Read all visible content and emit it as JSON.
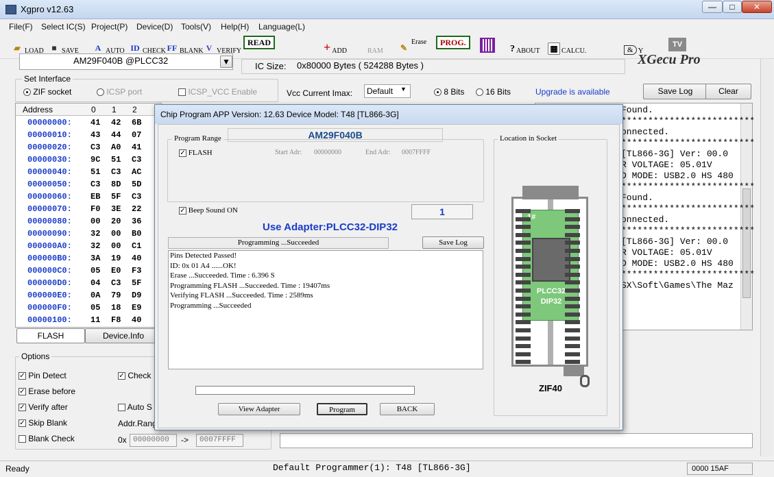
{
  "window": {
    "title": "Xgpro v12.63",
    "min": "—",
    "max": "□",
    "close": "✕"
  },
  "menu": [
    "File(F)",
    "Select IC(S)",
    "Project(P)",
    "Device(D)",
    "Tools(V)",
    "Help(H)",
    "Language(L)"
  ],
  "toolbar": {
    "load": "LOAD",
    "save": "SAVE",
    "auto": "AUTO",
    "check": "CHECK",
    "blank": "BLANK",
    "verify": "VERIFY",
    "read": "READ",
    "add": "ADD",
    "ram": "RAM",
    "erase": "Erase",
    "prog": "PROG.",
    "about": "ABOUT",
    "calcu": "CALCU.",
    "gate": "&",
    "gate_out": "Y",
    "tv": "TV"
  },
  "chip": {
    "name": "AM29F040B @PLCC32",
    "ic_size_label": "IC Size:",
    "ic_size_value": "0x80000 Bytes ( 524288 Bytes )",
    "brand": "XGecu Pro"
  },
  "interface": {
    "label": "Set Interface",
    "zif": "ZIF socket",
    "icsp": "ICSP port",
    "icsp_vcc": "ICSP_VCC Enable",
    "vcc_label": "Vcc Current Imax:",
    "vcc_value": "Default",
    "bits8": "8 Bits",
    "bits16": "16 Bits",
    "upgrade": "Upgrade is available",
    "save_log": "Save Log",
    "clear": "Clear"
  },
  "hex": {
    "header_addr": "Address",
    "cols": [
      "0",
      "1",
      "2"
    ],
    "rows": [
      {
        "addr": "00000000:",
        "b": [
          "41",
          "42",
          "6B"
        ]
      },
      {
        "addr": "00000010:",
        "b": [
          "43",
          "44",
          "07"
        ]
      },
      {
        "addr": "00000020:",
        "b": [
          "C3",
          "A0",
          "41"
        ]
      },
      {
        "addr": "00000030:",
        "b": [
          "9C",
          "51",
          "C3"
        ]
      },
      {
        "addr": "00000040:",
        "b": [
          "51",
          "C3",
          "AC"
        ]
      },
      {
        "addr": "00000050:",
        "b": [
          "C3",
          "8D",
          "5D"
        ]
      },
      {
        "addr": "00000060:",
        "b": [
          "EB",
          "5F",
          "C3"
        ]
      },
      {
        "addr": "00000070:",
        "b": [
          "F0",
          "3E",
          "22"
        ]
      },
      {
        "addr": "00000080:",
        "b": [
          "00",
          "20",
          "36"
        ]
      },
      {
        "addr": "00000090:",
        "b": [
          "32",
          "00",
          "B0"
        ]
      },
      {
        "addr": "000000A0:",
        "b": [
          "32",
          "00",
          "C1"
        ]
      },
      {
        "addr": "000000B0:",
        "b": [
          "3A",
          "19",
          "40"
        ]
      },
      {
        "addr": "000000C0:",
        "b": [
          "05",
          "E0",
          "F3"
        ]
      },
      {
        "addr": "000000D0:",
        "b": [
          "04",
          "C3",
          "5F"
        ]
      },
      {
        "addr": "000000E0:",
        "b": [
          "0A",
          "79",
          "D9"
        ]
      },
      {
        "addr": "000000F0:",
        "b": [
          "05",
          "18",
          "E9"
        ]
      },
      {
        "addr": "00000100:",
        "b": [
          "11",
          "F8",
          "40"
        ]
      }
    ]
  },
  "tabs": {
    "flash": "FLASH",
    "device_info": "Device.Info"
  },
  "options": {
    "label": "Options",
    "pin_detect": "Pin Detect",
    "check": "Check",
    "erase_before": "Erase before",
    "verify_after": "Verify after",
    "auto": "Auto S",
    "skip_blank": "Skip Blank",
    "addr_range": "Addr.Rang",
    "blank_check": "Blank Check",
    "ox": "0x",
    "start": "00000000",
    "arrow": "->",
    "end": "0007FFFF"
  },
  "log": [
    "Found.",
    "*************************",
    "onnected.",
    "*************************",
    "[TL866-3G] Ver: 00.0",
    "R VOLTAGE: 05.01V",
    "D MODE: USB2.0 HS 480",
    "*************************",
    "Found.",
    "*************************",
    "onnected.",
    "*************************",
    "[TL866-3G] Ver: 00.0",
    "R VOLTAGE: 05.01V",
    "D MODE: USB2.0 HS 480",
    "*************************",
    "SX\\Soft\\Games\\The Maz"
  ],
  "log_top": "No Programmer Found.",
  "dialog": {
    "title": "Chip Program   APP Version: 12.63 Device Model: T48 [TL866-3G]",
    "range_label": "Program Range",
    "chip": "AM29F040B",
    "flash": "FLASH",
    "start_label": "Start Adr:",
    "start": "00000000",
    "end_label": "End Adr:",
    "end": "0007FFFF",
    "beep": "Beep Sound ON",
    "count": "1",
    "adapter": "Use Adapter:PLCC32-DIP32",
    "status": "Programming  ...Succeeded",
    "save_log": "Save Log",
    "messages": [
      "Pins Detected Passed!",
      "ID: 0x 01 A4 ......OK!",
      "Erase  ...Succeeded. Time : 6.396 S",
      "Programming FLASH ...Succeeded. Time : 19407ms",
      "Verifying FLASH ...Succeeded. Time : 2589ms",
      "Programming  ...Succeeded"
    ],
    "view_adapter": "View Adapter",
    "program": "Program",
    "back": "BACK",
    "location_label": "Location in Socket",
    "pin1": "1#",
    "chip_label1": "PLCC32",
    "chip_label2": "DIP32",
    "zif": "ZIF40"
  },
  "status": {
    "ready": "Ready",
    "programmer": "Default Programmer(1): T48 [TL866-3G]",
    "code": "0000 15AF"
  },
  "colors": {
    "blue_text": "#1a3cc8",
    "green_chip": "#7dc87a",
    "upgrade": "#1a3cc8"
  }
}
